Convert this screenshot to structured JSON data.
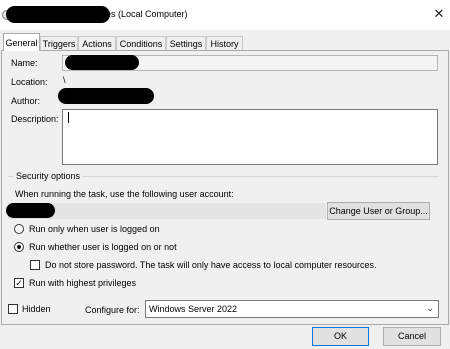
{
  "window": {
    "title_suffix": "es (Local Computer)",
    "close_glyph": "✕"
  },
  "tabs": [
    {
      "label": "General",
      "active": true
    },
    {
      "label": "Triggers"
    },
    {
      "label": "Actions"
    },
    {
      "label": "Conditions"
    },
    {
      "label": "Settings"
    },
    {
      "label": "History"
    }
  ],
  "general": {
    "name_label": "Name:",
    "location_label": "Location:",
    "location_value": "\\",
    "author_label": "Author:",
    "description_label": "Description:"
  },
  "security": {
    "legend": "Security options",
    "account_prompt": "When running the task, use the following user account:",
    "change_user_button": "Change User or Group...",
    "run_logged_on": "Run only when user is logged on",
    "run_whether": "Run whether user is logged on or not",
    "selected_option": "run_whether",
    "no_store_password": "Do not store password.  The task will only have access to local computer resources.",
    "no_store_password_checked": false,
    "highest_privileges": "Run with highest privileges",
    "highest_privileges_checked": true
  },
  "footer": {
    "hidden_label": "Hidden",
    "hidden_checked": false,
    "configure_label": "Configure for:",
    "configure_value": "Windows Server 2022",
    "ok_button": "OK",
    "cancel_button": "Cancel"
  }
}
